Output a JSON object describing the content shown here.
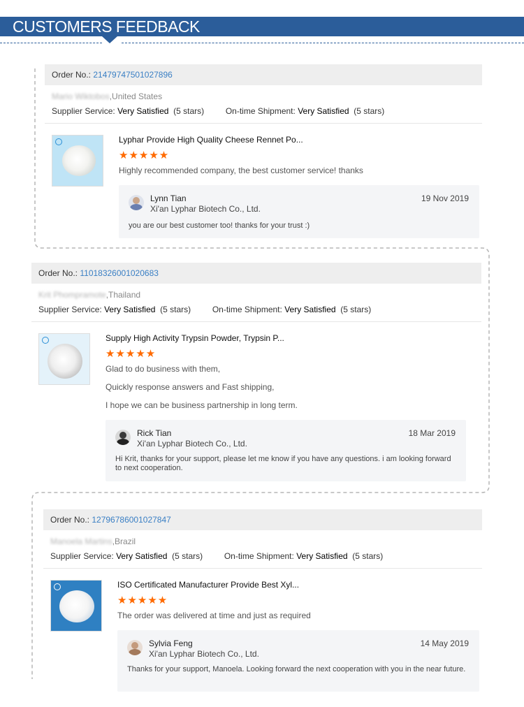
{
  "header": {
    "title": "CUSTOMERS FEEDBACK"
  },
  "colors": {
    "brand": "#2b5d9a",
    "link": "#3a7fc4",
    "star": "#ff6a00",
    "reply_bg": "#f4f5f7"
  },
  "reviews": [
    {
      "order_label": "Order No.:",
      "order_no": "21479747501027896",
      "buyer_name": "Mario Wiktobos",
      "buyer_country": ",United States",
      "supplier_label": "Supplier Service:",
      "supplier_value": "Very Satisfied",
      "supplier_stars": "(5 stars)",
      "shipment_label": "On-time Shipment:",
      "shipment_value": "Very Satisfied",
      "shipment_stars": "(5 stars)",
      "product_title": "Lyphar Provide High Quality Cheese Rennet Po...",
      "stars": "★★★★★",
      "comments": [
        "Highly recommended company, the best customer service! thanks"
      ],
      "reply": {
        "name": "Lynn Tian",
        "company": "Xi'an Lyphar Biotech Co., Ltd.",
        "date": "19 Nov 2019",
        "text": "you are our best customer too! thanks for your trust :)"
      }
    },
    {
      "order_label": "Order No.:",
      "order_no": "11018326001020683",
      "buyer_name": "Krit Phompramote",
      "buyer_country": ",Thailand",
      "supplier_label": "Supplier Service:",
      "supplier_value": "Very Satisfied",
      "supplier_stars": "(5 stars)",
      "shipment_label": "On-time Shipment:",
      "shipment_value": "Very Satisfied",
      "shipment_stars": "(5 stars)",
      "product_title": "Supply High Activity Trypsin Powder, Trypsin P...",
      "stars": "★★★★★",
      "comments": [
        "Glad to do business with them,",
        "Quickly response answers and Fast shipping,",
        "I hope we can be business partnership in long term."
      ],
      "reply": {
        "name": "Rick Tian",
        "company": "Xi'an Lyphar Biotech Co., Ltd.",
        "date": "18 Mar 2019",
        "text": "Hi Krit, thanks for your support, please let me know if you have any questions. i am looking forward to next cooperation."
      }
    },
    {
      "order_label": "Order No.:",
      "order_no": "12796786001027847",
      "buyer_name": "Manoela Martins",
      "buyer_country": ",Brazil",
      "supplier_label": "Supplier Service:",
      "supplier_value": "Very Satisfied",
      "supplier_stars": "(5 stars)",
      "shipment_label": "On-time Shipment:",
      "shipment_value": "Very Satisfied",
      "shipment_stars": "(5 stars)",
      "product_title": "ISO Certificated Manufacturer Provide Best Xyl...",
      "stars": "★★★★★",
      "comments": [
        "The order was delivered at time and just as required"
      ],
      "reply": {
        "name": "Sylvia Feng",
        "company": "Xi'an Lyphar Biotech Co., Ltd.",
        "date": "14 May 2019",
        "text": "Thanks for your support, Manoela. Looking forward the next cooperation with you in the near future."
      }
    }
  ]
}
